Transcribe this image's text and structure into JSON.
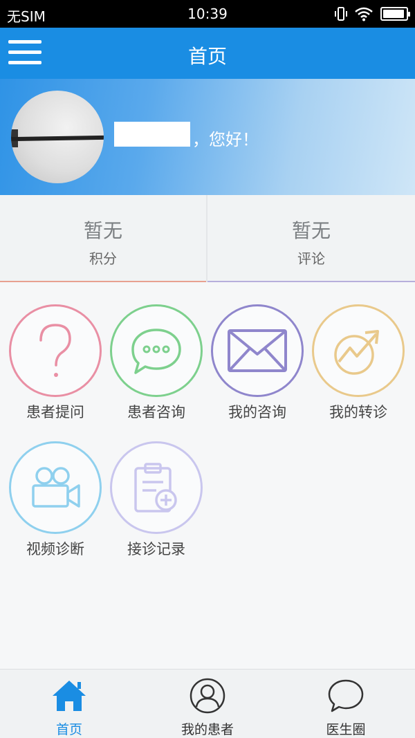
{
  "status_bar": {
    "carrier": "无SIM",
    "time": "10:39",
    "battery_level": 0.95
  },
  "header": {
    "title": "首页"
  },
  "profile": {
    "greeting": "，您好！"
  },
  "stats": [
    {
      "value": "暂无",
      "label": "积分"
    },
    {
      "value": "暂无",
      "label": "评论"
    }
  ],
  "grid": [
    {
      "label": "患者提问",
      "icon": "question-icon",
      "color": "#e98fa4"
    },
    {
      "label": "患者咨询",
      "icon": "chat-bubble-icon",
      "color": "#7dd08d"
    },
    {
      "label": "我的咨询",
      "icon": "envelope-icon",
      "color": "#8f86cc"
    },
    {
      "label": "我的转诊",
      "icon": "referral-arrow-icon",
      "color": "#e9c98b"
    },
    {
      "label": "视频诊断",
      "icon": "video-camera-icon",
      "color": "#8fd0ee"
    },
    {
      "label": "接诊记录",
      "icon": "clipboard-plus-icon",
      "color": "#c9c6ee"
    }
  ],
  "bottom_nav": [
    {
      "label": "首页",
      "icon": "home-icon",
      "active": true
    },
    {
      "label": "我的患者",
      "icon": "user-icon",
      "active": false
    },
    {
      "label": "医生圈",
      "icon": "chat-icon",
      "active": false
    }
  ],
  "colors": {
    "primary": "#1a8de3",
    "status_bar": "#000000"
  }
}
